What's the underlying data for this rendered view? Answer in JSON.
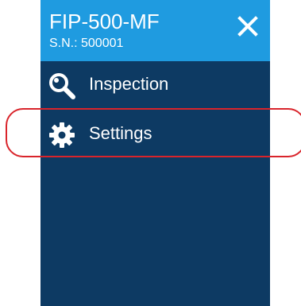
{
  "header": {
    "device_name": "FIP-500-MF",
    "serial": "S.N.: 500001",
    "close_icon": "close-icon"
  },
  "menu": {
    "items": [
      {
        "label": "Inspection",
        "icon": "magnifier-icon"
      },
      {
        "label": "Settings",
        "icon": "gear-icon"
      }
    ]
  },
  "colors": {
    "header_bg": "#1f9be0",
    "panel_bg": "#0d3a63",
    "text": "#ffffff",
    "highlight": "#d9242b"
  }
}
